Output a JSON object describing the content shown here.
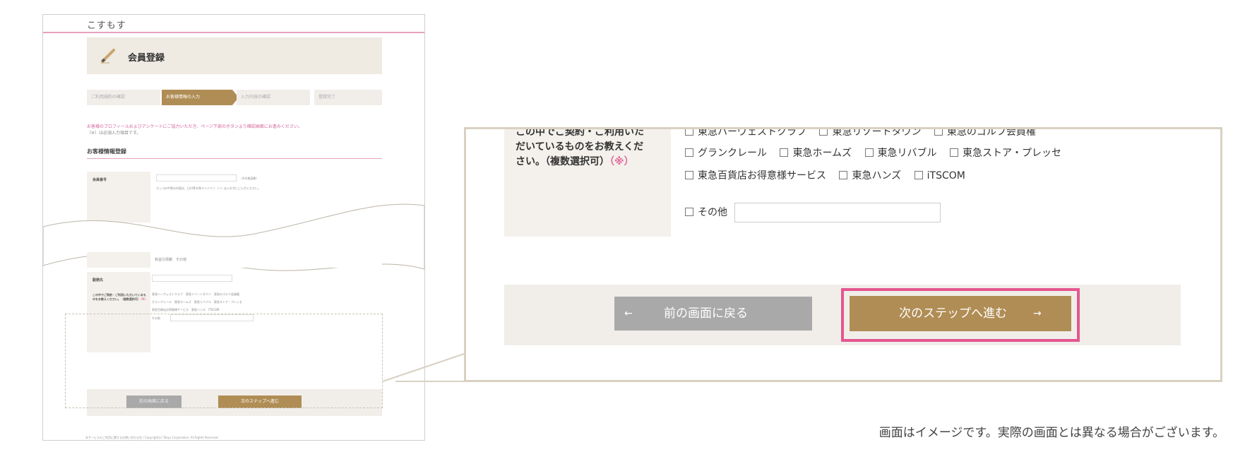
{
  "thumbnail": {
    "logo": "こすもす",
    "header_title": "会員登録",
    "steps": [
      {
        "label": "ご利用規約の確認",
        "active": false
      },
      {
        "label": "お客様情報の入力",
        "active": true
      },
      {
        "label": "入力内容の確認",
        "active": false
      },
      {
        "label": "登録完了",
        "active": false
      }
    ],
    "note_line1": "お客様のプロフィールおよびアンケートにご協力いただき、ページ下部のボタンより確認画面にお進みください。",
    "note_line2": "（※）は必須入力項目です。",
    "section_title": "お客様情報登録",
    "field1_label": "会員番号",
    "field1_help": "カッコの中等の内容は、日付等半角でハイフン（ー）は入れずにご入力ください。",
    "field1_suffix": "（※半角英数）",
    "radio_options": [
      "有益な情報",
      "その他"
    ],
    "field2_label": "勤務先",
    "question_label": "この中でご契約・ご利用いただいているものをお教えください。（複数選択可）",
    "question_mark": "（※）",
    "options": [
      "東急ハーヴェストクラブ",
      "東急リゾートタウン",
      "東急のゴルフ会員権",
      "グランクレール",
      "東急ホームズ",
      "東急リバブル",
      "東急ストア・プレッセ",
      "東急百貨店お得意様サービス",
      "東急ハンズ",
      "iTSCOM",
      "その他"
    ],
    "back_button": "前の画面に戻る",
    "next_button": "次のステップへ進む",
    "footer": "本サービスのご利用に関するお問い合わせ先 / Copyright(c) Tokyu Corporation. All Rights Reserved."
  },
  "zoom": {
    "question_line1": "この中でご契約・ご利用いた",
    "question_line2": "だいているものをお教えくだ",
    "question_line3": "さい。（複数選択可）",
    "question_mark": "（※）",
    "row1": [
      "東急ハーヴェストクラブ",
      "東急リゾートタウン",
      "東急のゴルフ会員権"
    ],
    "row2": [
      "グランクレール",
      "東急ホームズ",
      "東急リバブル",
      "東急ストア・プレッセ"
    ],
    "row3": [
      "東急百貨店お得意様サービス",
      "東急ハンズ",
      "iTSCOM"
    ],
    "other_label": "その他",
    "back_button": "前の画面に戻る",
    "back_arrow": "←",
    "next_button": "次のステップへ進む",
    "next_arrow": "→"
  },
  "caption": "画面はイメージです。実際の画面とは異なる場合がございます。",
  "colors": {
    "brand": "#b08d55",
    "highlight": "#e5568f",
    "required": "#e0669b",
    "accent_line": "#e7a1bd"
  }
}
